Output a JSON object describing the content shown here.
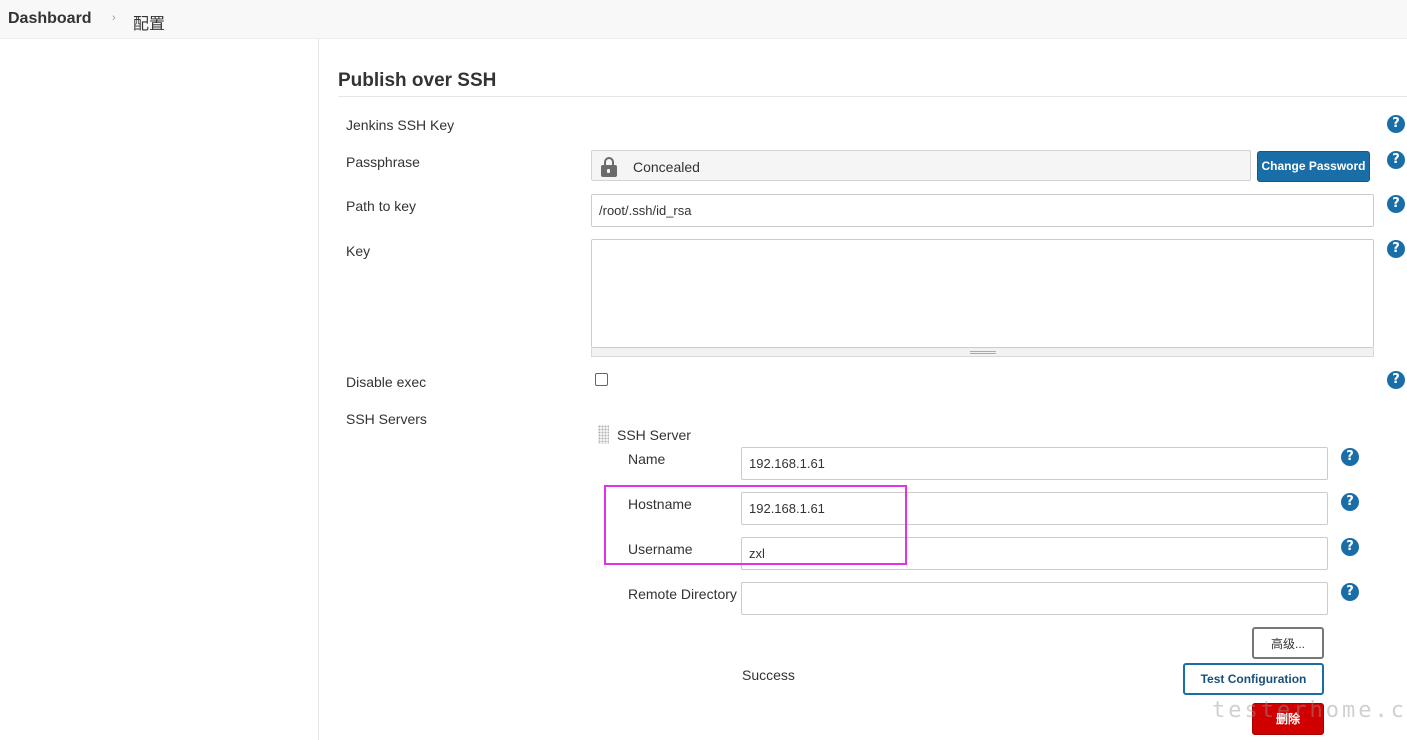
{
  "breadcrumb": {
    "dashboard": "Dashboard",
    "separator": "›",
    "current": "配置"
  },
  "section": {
    "title": "Publish over SSH"
  },
  "fields": {
    "jenkins_ssh_key_label": "Jenkins SSH Key",
    "passphrase_label": "Passphrase",
    "passphrase_value": "Concealed",
    "change_password_label": "Change Password",
    "path_to_key_label": "Path to key",
    "path_to_key_value": "/root/.ssh/id_rsa",
    "key_label": "Key",
    "key_value": "",
    "disable_exec_label": "Disable exec",
    "disable_exec_checked": false,
    "ssh_servers_label": "SSH Servers"
  },
  "ssh_server": {
    "header": "SSH Server",
    "name_label": "Name",
    "name_value": "192.168.1.61",
    "hostname_label": "Hostname",
    "hostname_value": "192.168.1.61",
    "username_label": "Username",
    "username_value": "zxl",
    "remote_directory_label": "Remote Directory",
    "remote_directory_value": "",
    "advanced_button": "高级...",
    "status_text": "Success",
    "test_button": "Test Configuration",
    "delete_button": "删除"
  },
  "help_icon_glyph": "?",
  "colors": {
    "primary": "#1a6ea8",
    "danger": "#d10000",
    "highlight": "#e530e5"
  },
  "watermark": "testerhome.com"
}
